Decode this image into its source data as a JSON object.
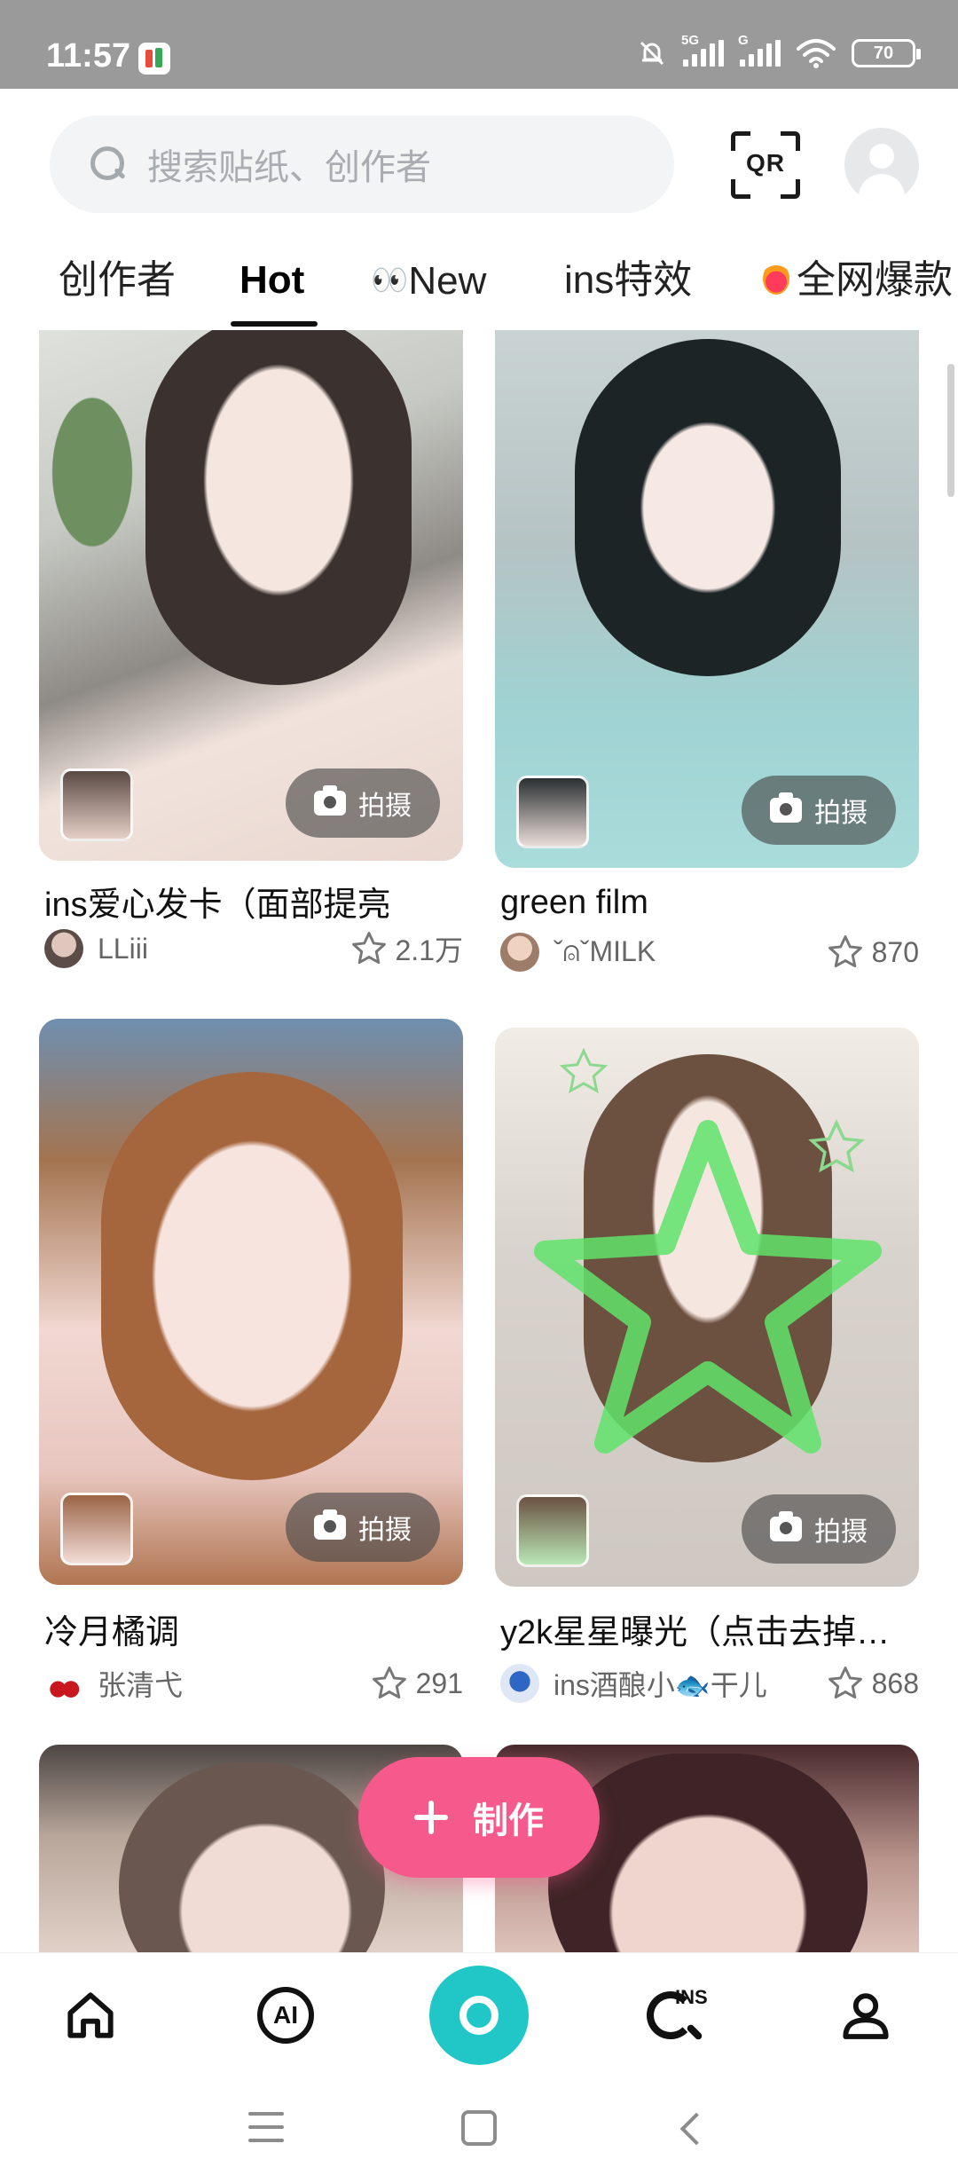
{
  "status_bar": {
    "time": "11:57",
    "signal1_label": "5G",
    "signal2_label": "G",
    "battery": "70"
  },
  "header": {
    "search_placeholder": "搜索贴纸、创作者",
    "qr_label": "QR"
  },
  "tabs": [
    {
      "label": "创作者",
      "active": false
    },
    {
      "label": "Hot",
      "active": true
    },
    {
      "label": "New",
      "active": false
    },
    {
      "label": "ins特效",
      "active": false
    },
    {
      "label": "全网爆款",
      "active": false
    }
  ],
  "tab_new_emoji": "👀",
  "cards": [
    {
      "title": "ins爱心发卡（面部提亮",
      "author": "LLiii",
      "likes": "2.1万",
      "shoot_label": "拍摄"
    },
    {
      "title": "green film",
      "author": "ˇ⍝ˇMILK",
      "likes": "870",
      "shoot_label": "拍摄"
    },
    {
      "title": "冷月橘调",
      "author": "张清弋",
      "likes": "291",
      "shoot_label": "拍摄"
    },
    {
      "title": "y2k星星曝光（点击去掉…",
      "author": "ins酒酿小🐟干儿",
      "likes": "868",
      "shoot_label": "拍摄"
    },
    {
      "title": "",
      "author": "",
      "likes": ""
    },
    {
      "title": "",
      "author": "",
      "likes": ""
    }
  ],
  "create_button": {
    "label": "制作"
  },
  "bottom_nav": {
    "ai_label": "AI",
    "ins_label": "INS"
  },
  "colors": {
    "accent_pink": "#f65a8c",
    "accent_teal": "#21c7c7",
    "status_bar": "#9a9a9a"
  },
  "icons": [
    "search-icon",
    "qr-scan-icon",
    "avatar-icon",
    "camera-icon",
    "star-icon",
    "plus-icon",
    "home-icon",
    "ai-icon",
    "capture-icon",
    "ins-search-icon",
    "profile-icon"
  ]
}
